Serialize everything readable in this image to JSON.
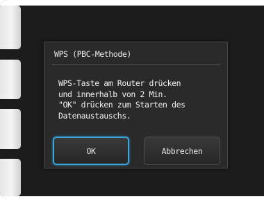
{
  "dialog": {
    "title": "WPS (PBC-Methode)",
    "message_lines": [
      "WPS-Taste am Router drücken",
      "und innerhalb von 2 Min.",
      "\"OK\" drücken zum Starten des",
      "Datenaustauschs."
    ],
    "ok_label": "OK",
    "cancel_label": "Abbrechen"
  },
  "colors": {
    "screen_background": "#1c1c1c",
    "dialog_background": "#2a2a2a",
    "focus_accent": "#3aa6dc",
    "side_tab": "#f0f0f0"
  }
}
